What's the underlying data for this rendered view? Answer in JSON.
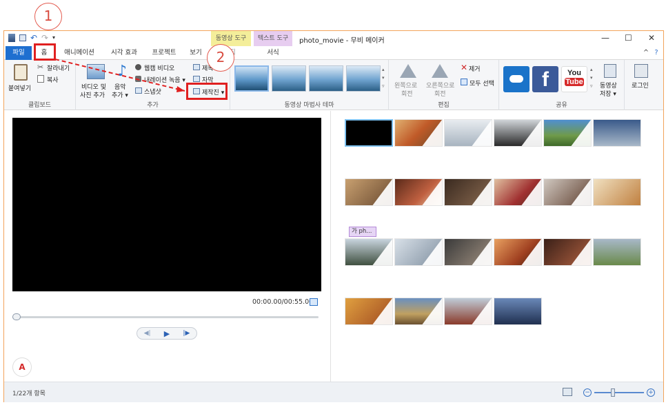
{
  "window": {
    "title": "photo_movie - 무비 메이커",
    "context_video_tools": "동영상 도구",
    "context_text_tools": "텍스트 도구"
  },
  "tabs": [
    {
      "label": "파일",
      "active": false
    },
    {
      "label": "홈",
      "active": true
    },
    {
      "label": "애니메이션"
    },
    {
      "label": "시각 효과"
    },
    {
      "label": "프로젝트"
    },
    {
      "label": "보기"
    },
    {
      "label": "편집"
    },
    {
      "label": "서식"
    }
  ],
  "ribbon": {
    "clipboard": {
      "label": "클립보드",
      "paste": "붙여넣기",
      "cut": "잘라내기",
      "copy": "복사"
    },
    "add": {
      "label": "추가",
      "add_video_photo_1": "비디오 및",
      "add_video_photo_2": "사진 추가",
      "add_music_1": "음악",
      "add_music_2": "추가 ▾",
      "webcam": "웹캠 비디오",
      "narration": "내레이션 녹음 ▾",
      "snapshot": "스냅샷",
      "title": "제목",
      "caption": "자막",
      "credits": "제작진 ▾"
    },
    "themes": {
      "label": "동영상 마법사 테마"
    },
    "editing": {
      "label": "편집",
      "rotate_left_1": "왼쪽으로",
      "rotate_left_2": "회전",
      "rotate_right_1": "오른쪽으로",
      "rotate_right_2": "회전",
      "remove": "제거",
      "select_all": "모두 선택"
    },
    "share": {
      "label": "공유",
      "youtube_1": "You",
      "youtube_2": "Tube",
      "save_movie_1": "동영상",
      "save_movie_2": "저장 ▾",
      "sign_in": "로그인"
    }
  },
  "player": {
    "time": "00:00.00/00:55.00",
    "progress": 0
  },
  "storyboard": {
    "title_chip": "가 ph..."
  },
  "status": {
    "items": "1/22개 항목"
  },
  "annotations": {
    "step1": "1",
    "step2": "2"
  },
  "logo_text": "A",
  "colors": {
    "file_tab": "#1e6fd0",
    "annotation_red": "#e02020",
    "window_border": "#f2a35a"
  }
}
